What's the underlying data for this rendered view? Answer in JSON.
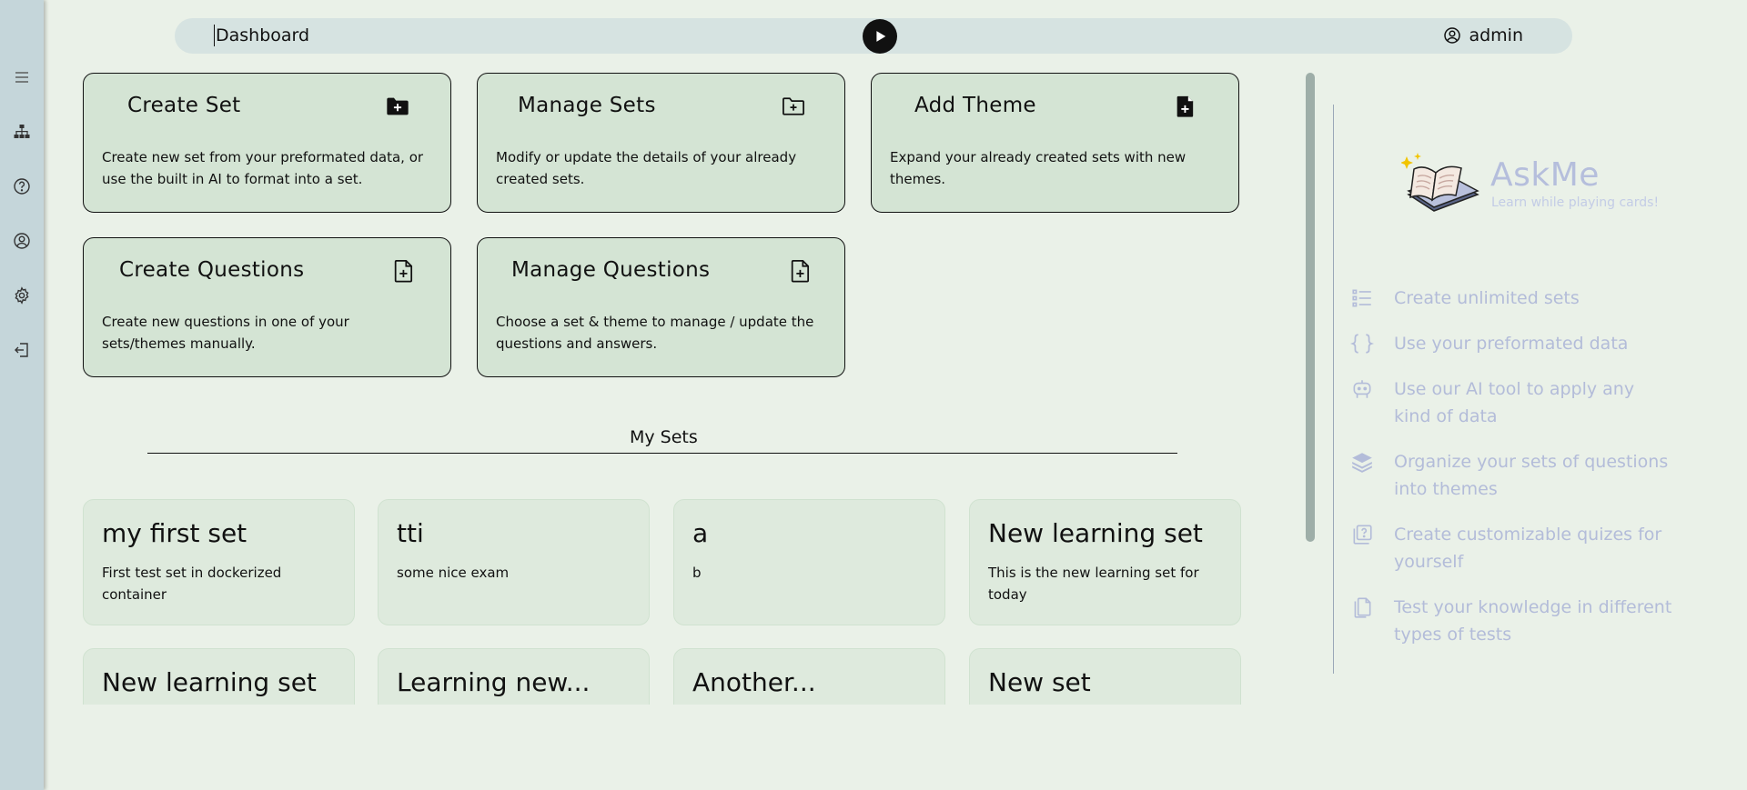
{
  "sidebar": {
    "items": [
      {
        "icon": "menu-icon"
      },
      {
        "icon": "sitemap-icon"
      },
      {
        "icon": "help-icon"
      },
      {
        "icon": "user-circle-icon"
      },
      {
        "icon": "settings-icon"
      },
      {
        "icon": "logout-icon"
      }
    ]
  },
  "topbar": {
    "title": "Dashboard",
    "play_icon": "play-icon",
    "user": "admin"
  },
  "actions": [
    {
      "title": "Create Set",
      "desc": "Create new set from your preformated data, or use the built in AI to format into a set.",
      "icon": "folder-plus-filled-icon"
    },
    {
      "title": "Manage Sets",
      "desc": "Modify or update the details of your already created sets.",
      "icon": "folder-plus-outline-icon"
    },
    {
      "title": "Add Theme",
      "desc": "Expand your already created sets with new themes.",
      "icon": "file-plus-filled-icon"
    },
    {
      "title": "Create Questions",
      "desc": "Create new questions in one of your sets/themes manually.",
      "icon": "file-plus-outline-icon"
    },
    {
      "title": "Manage Questions",
      "desc": "Choose a set & theme to manage / update the questions and answers.",
      "icon": "file-plus-outline-icon"
    }
  ],
  "my_sets": {
    "heading": "My Sets",
    "items": [
      {
        "name": "my first set",
        "desc": "First test set in dockerized container"
      },
      {
        "name": "tti",
        "desc": "some nice exam"
      },
      {
        "name": "a",
        "desc": "b"
      },
      {
        "name": "New learning set",
        "desc": "This is the new learning set for today"
      },
      {
        "name": "New learning set",
        "desc": ""
      },
      {
        "name": "Learning new...",
        "desc": ""
      },
      {
        "name": "Another...",
        "desc": ""
      },
      {
        "name": "New set",
        "desc": ""
      }
    ]
  },
  "brand": {
    "name": "AskMe",
    "tagline": "Learn while playing cards!"
  },
  "features": [
    {
      "text": "Create unlimited sets",
      "icon": "list-icon"
    },
    {
      "text": "Use your preformated data",
      "icon": "braces-icon"
    },
    {
      "text": "Use our AI tool to apply any kind of data",
      "icon": "robot-icon"
    },
    {
      "text": "Organize your sets of questions into themes",
      "icon": "layers-icon"
    },
    {
      "text": "Create customizable quizes for yourself",
      "icon": "quiz-icon"
    },
    {
      "text": "Test your knowledge in different types of tests",
      "icon": "documents-icon"
    }
  ],
  "colors": {
    "background": "#eaf1e8",
    "sidebar": "#c5d6da",
    "card": "#d4e4d4",
    "muted_accent": "#b3bcd9"
  }
}
